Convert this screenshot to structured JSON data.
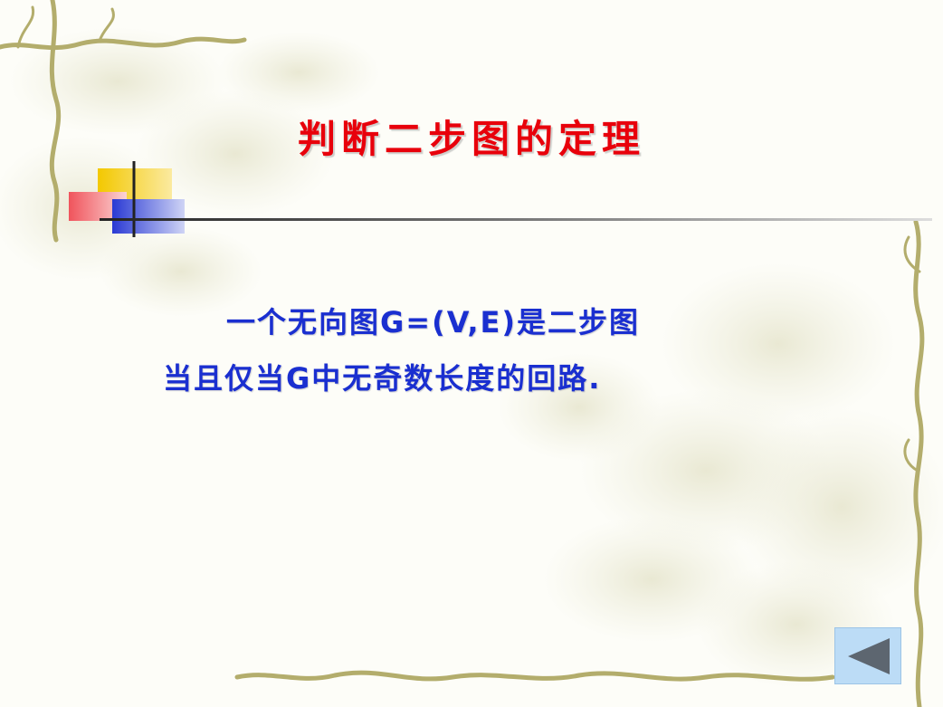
{
  "slide": {
    "title": "判断二步图的定理",
    "body": {
      "line1": "一个无向图G=(V,E)是二步图",
      "line2": "当且仅当G中无奇数长度的回路."
    },
    "nav": {
      "back_icon": "triangle-left-icon"
    },
    "colors": {
      "title": "#e8000b",
      "body": "#1a2fd0",
      "vine": "#b3ad6c",
      "nav_button": "#bcdcf6"
    }
  }
}
